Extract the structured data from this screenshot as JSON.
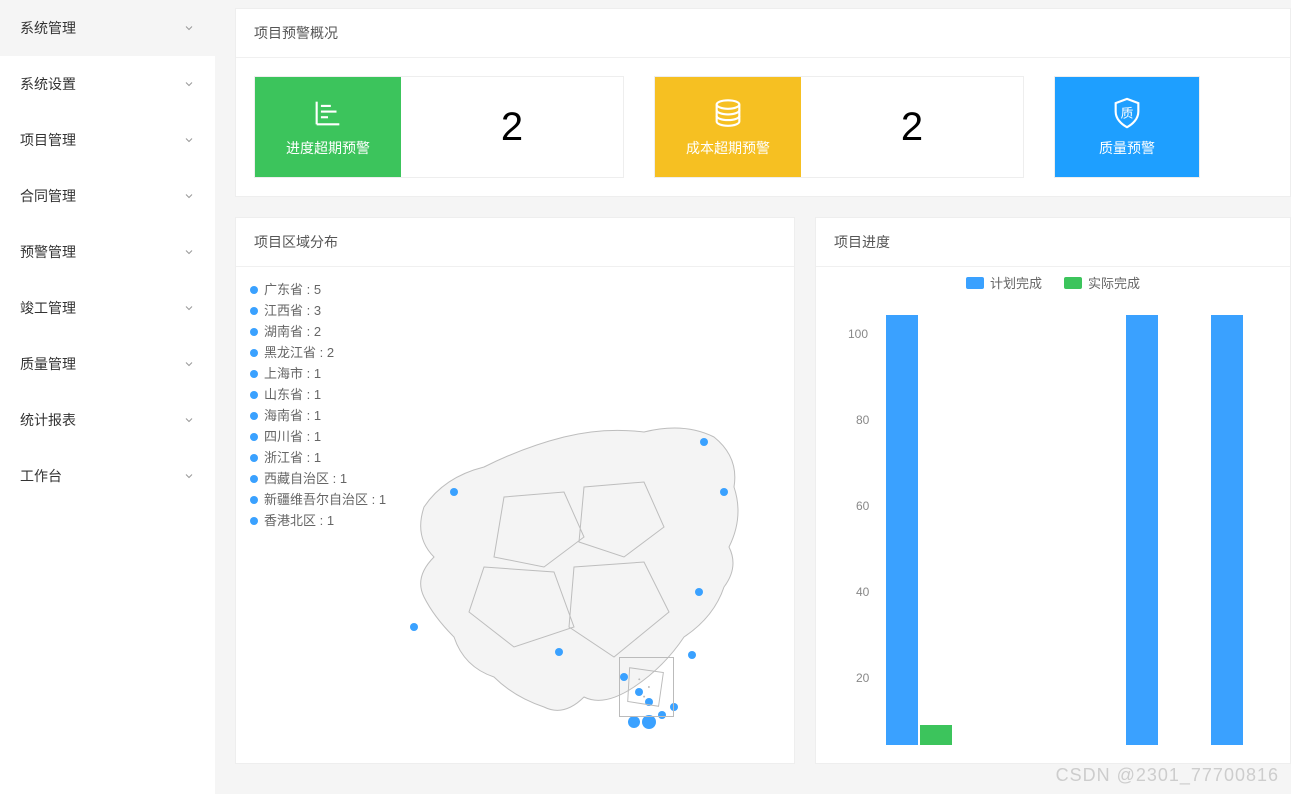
{
  "sidebar": {
    "items": [
      {
        "label": "系统管理"
      },
      {
        "label": "系统设置"
      },
      {
        "label": "项目管理"
      },
      {
        "label": "合同管理"
      },
      {
        "label": "预警管理"
      },
      {
        "label": "竣工管理"
      },
      {
        "label": "质量管理"
      },
      {
        "label": "统计报表"
      },
      {
        "label": "工作台"
      }
    ]
  },
  "overview": {
    "title": "项目预警概况",
    "cards": [
      {
        "label": "进度超期预警",
        "value": "2"
      },
      {
        "label": "成本超期预警",
        "value": "2"
      },
      {
        "label": "质量预警"
      }
    ]
  },
  "regions": {
    "title": "项目区域分布",
    "list": [
      {
        "text": "广东省 : 5"
      },
      {
        "text": "江西省 : 3"
      },
      {
        "text": "湖南省 : 2"
      },
      {
        "text": "黑龙江省 : 2"
      },
      {
        "text": "上海市 : 1"
      },
      {
        "text": "山东省 : 1"
      },
      {
        "text": "海南省 : 1"
      },
      {
        "text": "四川省 : 1"
      },
      {
        "text": "浙江省 : 1"
      },
      {
        "text": "西藏自治区 : 1"
      },
      {
        "text": "新疆维吾尔自治区 : 1"
      },
      {
        "text": "香港北区 : 1"
      }
    ]
  },
  "progress": {
    "title": "项目进度",
    "legend": {
      "planned": "计划完成",
      "actual": "实际完成"
    }
  },
  "chart_data": {
    "type": "bar",
    "series": [
      {
        "name": "计划完成",
        "values": [
          100,
          100,
          100
        ]
      },
      {
        "name": "实际完成",
        "values": [
          5,
          0,
          0
        ]
      }
    ],
    "ylim": [
      0,
      100
    ],
    "yticks": [
      20,
      40,
      60,
      80,
      100
    ]
  },
  "watermark": "CSDN @2301_77700816"
}
